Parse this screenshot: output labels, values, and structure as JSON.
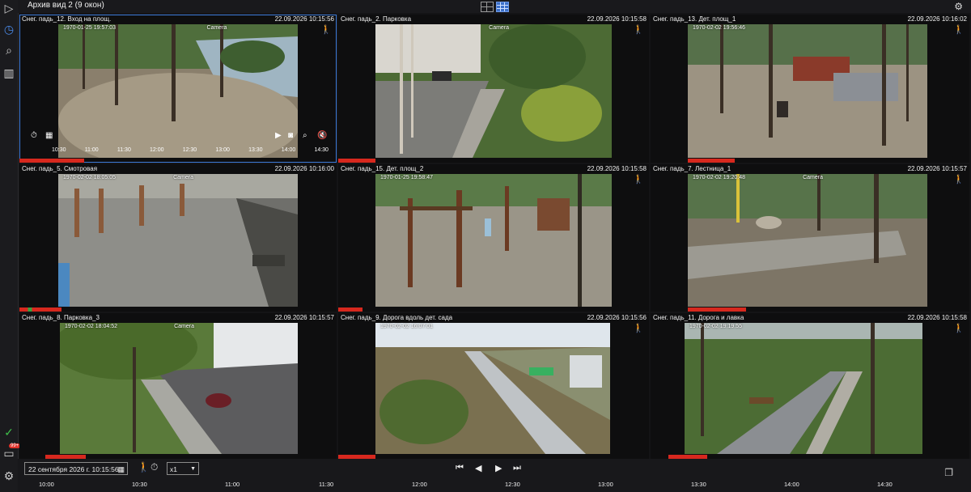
{
  "window": {
    "title": "Архив вид 2 (9 окон)"
  },
  "cameras": [
    {
      "title": "Снег. падь_12. Вход на площ.",
      "time": "22.09.2026 10:15:56",
      "osd_ts": "1970-01-25 19:57:03",
      "osd_cam": "Camera",
      "motion": true
    },
    {
      "title": "Снег. падь_2. Парковка",
      "time": "22.09.2026 10:15:58",
      "osd_ts": "",
      "osd_cam": "Camera",
      "motion": true
    },
    {
      "title": "Снег. падь_13. Дет. площ_1",
      "time": "22.09.2026 10:16:02",
      "osd_ts": "1970-02-02 19:56:46",
      "osd_cam": "",
      "motion": true
    },
    {
      "title": "Снег. падь_5. Смотровая",
      "time": "22.09.2026 10:16:00",
      "osd_ts": "1970-02-02 18:05:05",
      "osd_cam": "Camera",
      "motion": false
    },
    {
      "title": "Снег. падь_15. Дет. площ_2",
      "time": "22.09.2026 10:15:58",
      "osd_ts": "1970-01-25 19:58:47",
      "osd_cam": "",
      "motion": true
    },
    {
      "title": "Снег. падь_7. Лестница_1",
      "time": "22.09.2026 10:15:57",
      "osd_ts": "1970-02-02 19:20:48",
      "osd_cam": "Camera",
      "motion": true
    },
    {
      "title": "Снег. падь_8. Парковка_3",
      "time": "22.09.2026 10:15:57",
      "osd_ts": "1970-02-02 18:04:52",
      "osd_cam": "Camera",
      "motion": false
    },
    {
      "title": "Снег. падь_9. Дорога вдоль дет. сада",
      "time": "22.09.2026 10:15:56",
      "osd_ts": "1970-02-02 16:07:01",
      "osd_cam": "",
      "motion": true
    },
    {
      "title": "Снег. падь_11. Дорога и лавка",
      "time": "22.09.2026 10:15:58",
      "osd_ts": "1970-02-02 19:19:55",
      "osd_cam": "",
      "motion": true
    }
  ],
  "cell_timeline": {
    "ticks": [
      "10:30",
      "11:00",
      "11:30",
      "12:00",
      "12:30",
      "13:00",
      "13:30",
      "14:00",
      "14:30"
    ]
  },
  "controls": {
    "date_value": "22 сентября 2026 г. 10:15:56",
    "speed_value": "x1"
  },
  "timeline": {
    "ticks": [
      "10:00",
      "10:30",
      "11:00",
      "11:30",
      "12:00",
      "12:30",
      "13:00",
      "13:30",
      "14:00",
      "14:30"
    ]
  },
  "sidebar": {
    "badge": "99+"
  },
  "colors": {
    "accent": "#3b6fc9",
    "alert": "#d7281e",
    "ok": "#3aa040"
  }
}
